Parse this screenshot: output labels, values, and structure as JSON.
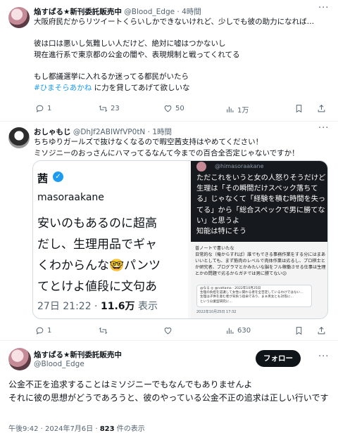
{
  "tweet1": {
    "name": "焔すぱる★新刊委託販売中",
    "handle": "@Blood_Edge",
    "time": "4時間",
    "text": "大阪府民だからリツイートくらいしかできないけれど、少しでも彼の助力になれば…\n\n彼は口は悪いし気難しい人だけど、絶対に嘘はつかないし\n現在進行系で東京都の公金の闇や、表現規制と戦ってくれてる\n\nもし都議選挙に入れるか迷ってる都民がいたら\n",
    "hashtag": "#ひまそらあかね",
    "text_after": " に力を貸してあげて欲しいな",
    "replies": "1",
    "retweets": "23",
    "likes": "50",
    "views": "1万"
  },
  "tweet2": {
    "name": "おしゃもじ",
    "handle": "@DhJf2ABIWfVP0tN",
    "time": "1時間",
    "text": "ちちゆりガールズで抜けなくなるので暇空茜支持はやめてください！\nミソジニーのおっさんにハマってるなんて今までの百合全否定じゃないですか！",
    "media_left": {
      "name_fragment": "茜",
      "verified": "✓",
      "handle_fragment": "masoraakane",
      "lines": [
        "安いのもあるのに超高",
        "だし、生理用品でギャ",
        "くわからんな🤓パンツ",
        "てとけよ値段に文句あ"
      ],
      "date": "27日 21:22 · ",
      "views": "11.6万",
      "views_suffix": " 表示"
    },
    "media_right": {
      "user": "@himasoraakane",
      "text": "ただこれをいうと女の人怒りそうだけど\n生理は「その瞬間だけスペック落ちてる」じゃなくて「経験を積む時間を失ってる」から「総合スペックで男に勝てない」と思うよ\n知能は特にそう",
      "note": "普ノートで書いたな\n日常的な（俺からすれば）誰でもできる事務作業をする分にはまあいいとしても、まず筋肉のレベルで肉体作業は劣るし、プロ棋士とか研究者、プログラマとかみたいな脳をフル稼働させる仕事は生理とかの問題で劣るからガチでは男に勝てない😕",
      "quote": "@なる ◎ @nattama · 2022年10月25日\n生理の負担を認識して女性に関わる者を全否定しているわけではない…\n生理は子供を産む者が背負う宿命であり、まぁ男女とも対等に…\nという分業型研究に…",
      "date": "2022年10月25日 17:32"
    },
    "replies": "1",
    "views": "630"
  },
  "tweet3": {
    "name": "焔すぱる★新刊委託販売中",
    "handle": "@Blood_Edge",
    "follow_label": "フォロー",
    "text": "公金不正を追求することはミソジニーでもなんでもありませんよ\nそれに彼の思想がどうであろうと、彼のやっている公金不正の追求は正しい行いです",
    "date": "午後9:42 · 2024年7月6日 · ",
    "views_count": "823",
    "views_label": " 件の表示"
  },
  "colors": {
    "accent": "#1d9bf0",
    "text": "#0f1419",
    "muted": "#536471"
  }
}
